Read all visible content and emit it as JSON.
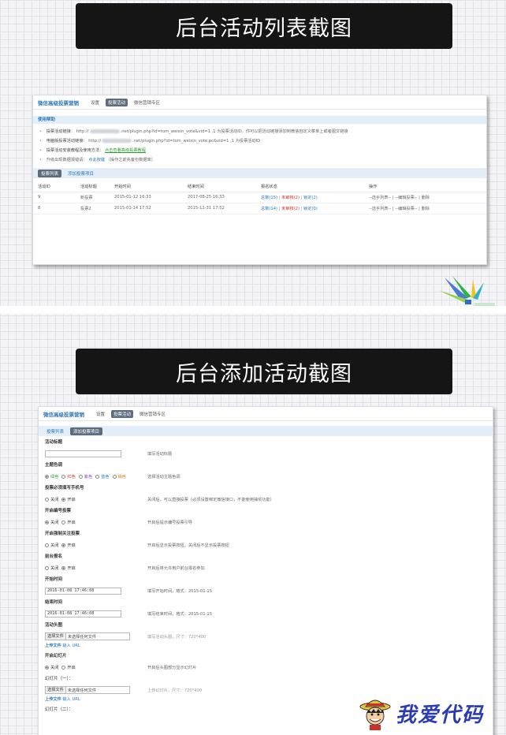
{
  "banners": {
    "list": "后台活动列表截图",
    "add": "后台添加活动截图"
  },
  "list_panel": {
    "app_title": "微信高级投票营销",
    "nav": [
      "设置",
      "投票活动",
      "微信营销专区"
    ],
    "help_title": "使用帮助",
    "help": {
      "l1_label": "投票活动链接：",
      "l1_pre": "http://",
      "l1_post": ".net/plugin.php?id=tom_weixin_vote&vid=1 ,1 为投票活动ID，你可以把活动链接添加到微信自定义菜单上或者图文链接",
      "l2_label": "电脑版投票活动链接：",
      "l2_pre": "http://",
      "l2_post": ".net/plugin.php?id=tom_weixin_vote:pc&vid=1 ,1 为投票活动ID",
      "l3_label": "投票活动安装教程及使用方法：",
      "l3_link": "点击查看高级投票教程",
      "l4_label": "升级出现数据报错请：",
      "l4_link": "点此按键",
      "l4_note": "（操作之前先备份数据库）"
    },
    "tabs": [
      "投票列表",
      "添加投票项目"
    ],
    "columns": [
      "活动ID",
      "活动标题",
      "开始时间",
      "结束时间",
      "报名状态",
      "操作"
    ],
    "rows": [
      {
        "id": "9",
        "title": "新投票",
        "start": "2015-01-12 16:33",
        "end": "2017-08-25 16:33",
        "s_all": "总数(15)",
        "s_pending": "未审核(2)",
        "s_locked": "锁定(2)",
        "ops": "--选手列表-- | --编辑投票-- | 删除"
      },
      {
        "id": "8",
        "title": "投票2",
        "start": "2015-01-14 17:52",
        "end": "2015-12-31 17:52",
        "s_all": "总数(14)",
        "s_pending": "未审核(2)",
        "s_locked": "锁定(0)",
        "ops": "--选手列表-- | --编辑投票-- | 删除"
      }
    ]
  },
  "add_panel": {
    "app_title": "微信高级投票营销",
    "nav": [
      "设置",
      "投票活动",
      "微信营销专区"
    ],
    "tabs": [
      "投票列表",
      "添加投票项目"
    ],
    "f_title": {
      "label": "活动标题",
      "tip": "填写活动标题"
    },
    "f_color": {
      "label": "主题色调",
      "options": [
        "绿色",
        "红色",
        "紫色",
        "蓝色",
        "橘色"
      ],
      "tip": "选择活动主题色调"
    },
    "f_phone": {
      "label": "投票必须填写手机号",
      "off": "关闭",
      "on": "开启",
      "tip": "关闭后，可以直接投票（必须设置绑定微信接口，不能使用抽奖功能）"
    },
    "f_code": {
      "label": "开启编号投票",
      "off": "关闭",
      "on": "开启",
      "tip": "开启后提示编号投票引导"
    },
    "f_follow": {
      "label": "开启强制关注投票",
      "off": "关闭",
      "on": "开启",
      "tip": "开启后显示投票按钮，关闭后不显示投票按钮"
    },
    "f_signup": {
      "label": "前台报名",
      "off": "关闭",
      "on": "开启",
      "tip": "开启后将允许用户前台报名参加"
    },
    "f_start": {
      "label": "开始时间",
      "value": "2016-01-08 17:46:08",
      "tip": "填写开始时间，格式：2015-01-15"
    },
    "f_end": {
      "label": "结束时间",
      "value": "2016-01-08 17:46:08",
      "tip": "填写结束时间，格式：2015-01-15"
    },
    "f_headimg": {
      "label": "活动头图",
      "btn": "选择文件",
      "file": "未选择任何文件",
      "tip": "填写活动头图，尺寸：720*400",
      "upload": "上传文件",
      "input_url": "输入 URL"
    },
    "f_slide": {
      "label": "开启幻灯片",
      "off": "关闭",
      "on": "开启",
      "tip": "开启后头图部分显示幻灯片"
    },
    "f_slide1": {
      "label": "幻灯片（一）：",
      "btn": "选择文件",
      "file": "未选择任何文件",
      "tip": "上传幻灯片，尺寸：720*400",
      "upload": "上传文件",
      "input_url": "输入 URL"
    },
    "f_slide2": {
      "label": "幻灯片（二）："
    }
  },
  "watermark": {
    "text": "我爱代码"
  }
}
